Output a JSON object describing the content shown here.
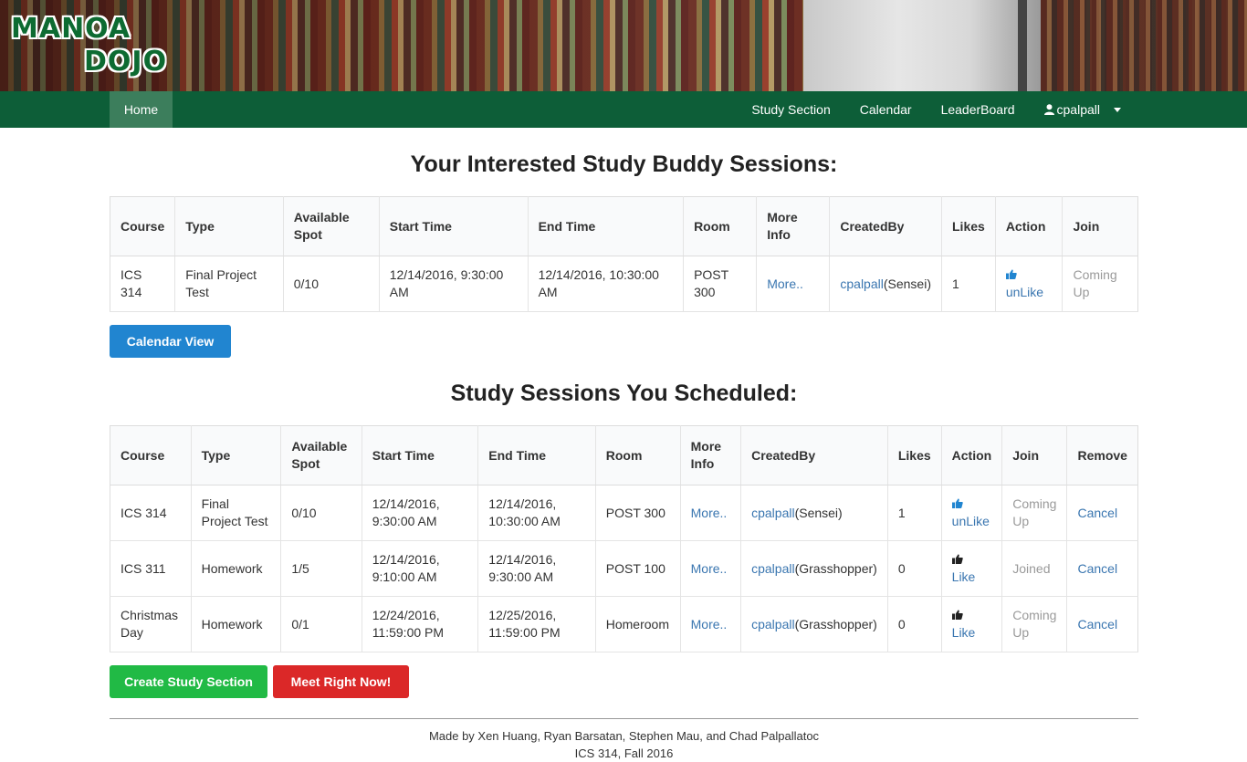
{
  "header": {
    "logo_line1": "MANOA",
    "logo_line2": "DOJO"
  },
  "nav": {
    "home": "Home",
    "study_section": "Study Section",
    "calendar": "Calendar",
    "leaderboard": "LeaderBoard",
    "user": "cpalpall"
  },
  "interested": {
    "title": "Your Interested Study Buddy Sessions:",
    "columns": [
      "Course",
      "Type",
      "Available Spot",
      "Start Time",
      "End Time",
      "Room",
      "More Info",
      "CreatedBy",
      "Likes",
      "Action",
      "Join"
    ],
    "rows": [
      {
        "course": "ICS 314",
        "type": "Final Project Test",
        "spot": "0/10",
        "start": "12/14/2016, 9:30:00 AM",
        "end": "12/14/2016, 10:30:00 AM",
        "room": "POST 300",
        "more": "More..",
        "creator": "cpalpall",
        "rank": "(Sensei)",
        "likes": "1",
        "action": "unLike",
        "join": "Coming Up"
      }
    ],
    "calendar_button": "Calendar View"
  },
  "scheduled": {
    "title": "Study Sessions You Scheduled:",
    "columns": [
      "Course",
      "Type",
      "Available Spot",
      "Start Time",
      "End Time",
      "Room",
      "More Info",
      "CreatedBy",
      "Likes",
      "Action",
      "Join",
      "Remove"
    ],
    "rows": [
      {
        "course": "ICS 314",
        "type": "Final Project Test",
        "spot": "0/10",
        "start": "12/14/2016, 9:30:00 AM",
        "end": "12/14/2016, 10:30:00 AM",
        "room": "POST 300",
        "more": "More..",
        "creator": "cpalpall",
        "rank": "(Sensei)",
        "likes": "1",
        "action": "unLike",
        "action_color": "#2185d0",
        "join": "Coming Up",
        "remove": "Cancel"
      },
      {
        "course": "ICS 311",
        "type": "Homework",
        "spot": "1/5",
        "start": "12/14/2016, 9:10:00 AM",
        "end": "12/14/2016, 9:30:00 AM",
        "room": "POST 100",
        "more": "More..",
        "creator": "cpalpall",
        "rank": "(Grasshopper)",
        "likes": "0",
        "action": "Like",
        "action_color": "#222222",
        "join": "Joined",
        "remove": "Cancel"
      },
      {
        "course": "Christmas Day",
        "type": "Homework",
        "spot": "0/1",
        "start": "12/24/2016, 11:59:00 PM",
        "end": "12/25/2016, 11:59:00 PM",
        "room": "Homeroom",
        "more": "More..",
        "creator": "cpalpall",
        "rank": "(Grasshopper)",
        "likes": "0",
        "action": "Like",
        "action_color": "#222222",
        "join": "Coming Up",
        "remove": "Cancel"
      }
    ],
    "create_button": "Create Study Section",
    "meet_button": "Meet Right Now!"
  },
  "footer": {
    "credits": "Made by Xen Huang, Ryan Barsatan, Stephen Mau, and Chad Palpallatoc",
    "course": "ICS 314, Fall 2016"
  },
  "colors": {
    "nav_green": "#0d5e38",
    "link_blue": "#3a76b0",
    "btn_blue": "#2185d0",
    "btn_green": "#21ba45",
    "btn_red": "#db2828"
  }
}
